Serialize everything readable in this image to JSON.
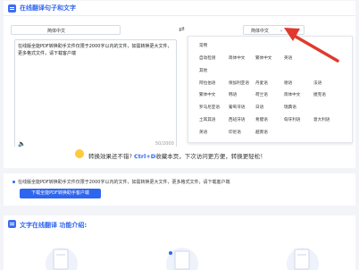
{
  "header": {
    "title": "在线翻译句子和文字"
  },
  "translator": {
    "source_lang": "简体中文",
    "target_lang": "简体中文",
    "input_text": "在线版全能PDF转换助手文件仅限于2000字以内的文件，如需转换更大文件，更多格式文件，请下载客户端",
    "char_count": "50/2000"
  },
  "language_menu": {
    "rows": [
      [
        "常用"
      ],
      [
        "自动检测",
        "简体中文",
        "繁体中文",
        "英语"
      ],
      [
        "其他"
      ],
      [
        "阿拉伯语",
        "保加利亚语",
        "丹麦语",
        "德语",
        "法语"
      ],
      [
        "繁体中文",
        "韩语",
        "荷兰语",
        "简体中文",
        "捷克语"
      ],
      [
        "罗马尼亚语",
        "葡萄牙语",
        "日语",
        "瑞典语",
        ""
      ],
      [
        "土耳其语",
        "西班牙语",
        "希腊语",
        "匈牙利语",
        "意大利语"
      ],
      [
        "英语",
        "印尼语",
        "越南语",
        "",
        ""
      ]
    ]
  },
  "tip": {
    "prefix": "转换效果还不错?",
    "shortcut": "Ctrl+D",
    "suffix": "收藏本页，下次访问更方便，转换更轻松！"
  },
  "info": {
    "notice": "在线版全能PDF转换助手文件仅限于2000字以内的文件，如需转换更大文件，更多格式文件，请下载客户端",
    "download_label": "下载全能PDF转换助手客户端"
  },
  "features": {
    "title": "文字在线翻译 功能介绍:"
  },
  "colors": {
    "accent": "#2f66f0",
    "arrow": "#e03a2e"
  }
}
